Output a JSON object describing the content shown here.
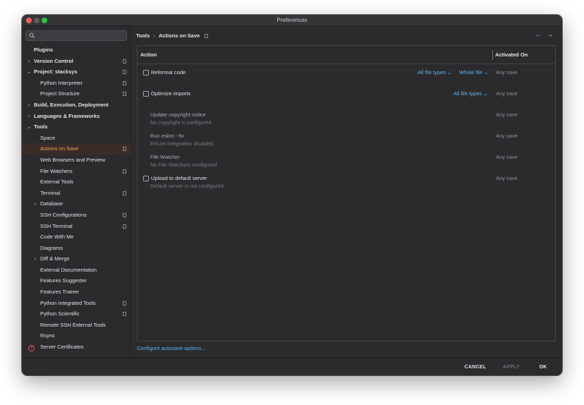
{
  "window": {
    "title": "Preferences"
  },
  "search": {
    "value": "",
    "icon": "search-icon"
  },
  "sidebar": {
    "items": [
      {
        "label": "Plugins",
        "bold": true,
        "indent": 0,
        "chevron": "",
        "badge": false
      },
      {
        "label": "Version Control",
        "bold": true,
        "indent": 0,
        "chevron": "›",
        "badge": true
      },
      {
        "label": "Project: stacksys",
        "bold": true,
        "indent": 0,
        "chevron": "⌄",
        "badge": true
      },
      {
        "label": "Python Interpreter",
        "bold": false,
        "indent": 1,
        "chevron": "",
        "badge": true
      },
      {
        "label": "Project Structure",
        "bold": false,
        "indent": 1,
        "chevron": "",
        "badge": true
      },
      {
        "label": "Build, Execution, Deployment",
        "bold": true,
        "indent": 0,
        "chevron": "›",
        "badge": false
      },
      {
        "label": "Languages & Frameworks",
        "bold": true,
        "indent": 0,
        "chevron": "›",
        "badge": false
      },
      {
        "label": "Tools",
        "bold": true,
        "indent": 0,
        "chevron": "⌄",
        "badge": false
      },
      {
        "label": "Space",
        "bold": false,
        "indent": 1,
        "chevron": "",
        "badge": false
      },
      {
        "label": "Actions on Save",
        "bold": false,
        "indent": 1,
        "chevron": "",
        "badge": true,
        "selected": true
      },
      {
        "label": "Web Browsers and Preview",
        "bold": false,
        "indent": 1,
        "chevron": "",
        "badge": false
      },
      {
        "label": "File Watchers",
        "bold": false,
        "indent": 1,
        "chevron": "",
        "badge": true
      },
      {
        "label": "External Tools",
        "bold": false,
        "indent": 1,
        "chevron": "",
        "badge": false
      },
      {
        "label": "Terminal",
        "bold": false,
        "indent": 1,
        "chevron": "",
        "badge": true
      },
      {
        "label": "Database",
        "bold": false,
        "indent": 1,
        "chevron": "›",
        "badge": false
      },
      {
        "label": "SSH Configurations",
        "bold": false,
        "indent": 1,
        "chevron": "",
        "badge": true
      },
      {
        "label": "SSH Terminal",
        "bold": false,
        "indent": 1,
        "chevron": "",
        "badge": true
      },
      {
        "label": "Code With Me",
        "bold": false,
        "indent": 1,
        "chevron": "",
        "badge": false
      },
      {
        "label": "Diagrams",
        "bold": false,
        "indent": 1,
        "chevron": "",
        "badge": false
      },
      {
        "label": "Diff & Merge",
        "bold": false,
        "indent": 1,
        "chevron": "›",
        "badge": false
      },
      {
        "label": "External Documentation",
        "bold": false,
        "indent": 1,
        "chevron": "",
        "badge": false
      },
      {
        "label": "Features Suggester",
        "bold": false,
        "indent": 1,
        "chevron": "",
        "badge": false
      },
      {
        "label": "Features Trainer",
        "bold": false,
        "indent": 1,
        "chevron": "",
        "badge": false
      },
      {
        "label": "Python Integrated Tools",
        "bold": false,
        "indent": 1,
        "chevron": "",
        "badge": true
      },
      {
        "label": "Python Scientific",
        "bold": false,
        "indent": 1,
        "chevron": "",
        "badge": true
      },
      {
        "label": "Remote SSH External Tools",
        "bold": false,
        "indent": 1,
        "chevron": "",
        "badge": false
      },
      {
        "label": "Rsync",
        "bold": false,
        "indent": 1,
        "chevron": "",
        "badge": false
      },
      {
        "label": "Server Certificates",
        "bold": false,
        "indent": 1,
        "chevron": "",
        "badge": false
      }
    ]
  },
  "breadcrumb": {
    "parent": "Tools",
    "separator": "›",
    "current": "Actions on Save"
  },
  "nav": {
    "back": "←",
    "forward": "→"
  },
  "table": {
    "headers": {
      "action": "Action",
      "activated_on": "Activated On"
    },
    "rows": [
      {
        "title": "Reformat code",
        "subtitle": "",
        "checkbox": true,
        "activated": "Any save",
        "links": [
          "All file types ⌄",
          "Whole file ⌄"
        ]
      },
      {
        "title": "Optimize imports",
        "subtitle": "",
        "checkbox": true,
        "activated": "Any save",
        "links": [
          "All file types ⌄"
        ]
      },
      {
        "title": "Update copyright notice",
        "subtitle": "No copyright is configured",
        "checkbox": false,
        "activated": "Any save",
        "links": []
      },
      {
        "title": "Run eslint --fix",
        "subtitle": "ESLint integration disabled",
        "checkbox": false,
        "activated": "Any save",
        "links": []
      },
      {
        "title": "File Watcher",
        "subtitle": "No File Watchers configured",
        "checkbox": false,
        "activated": "Any save",
        "links": []
      },
      {
        "title": "Upload to default server",
        "subtitle": "Default server is not configured",
        "checkbox": true,
        "activated": "Any save",
        "links": []
      }
    ]
  },
  "configure_link": "Configure autosave options...",
  "footer": {
    "cancel": "CANCEL",
    "apply": "APPLY",
    "ok": "OK",
    "help_icon": "question-circle-icon"
  },
  "colors": {
    "accent_selected": "#f0a25a",
    "link": "#5fb7f2",
    "background": "#2b2b2d",
    "help": "#e0555f"
  }
}
